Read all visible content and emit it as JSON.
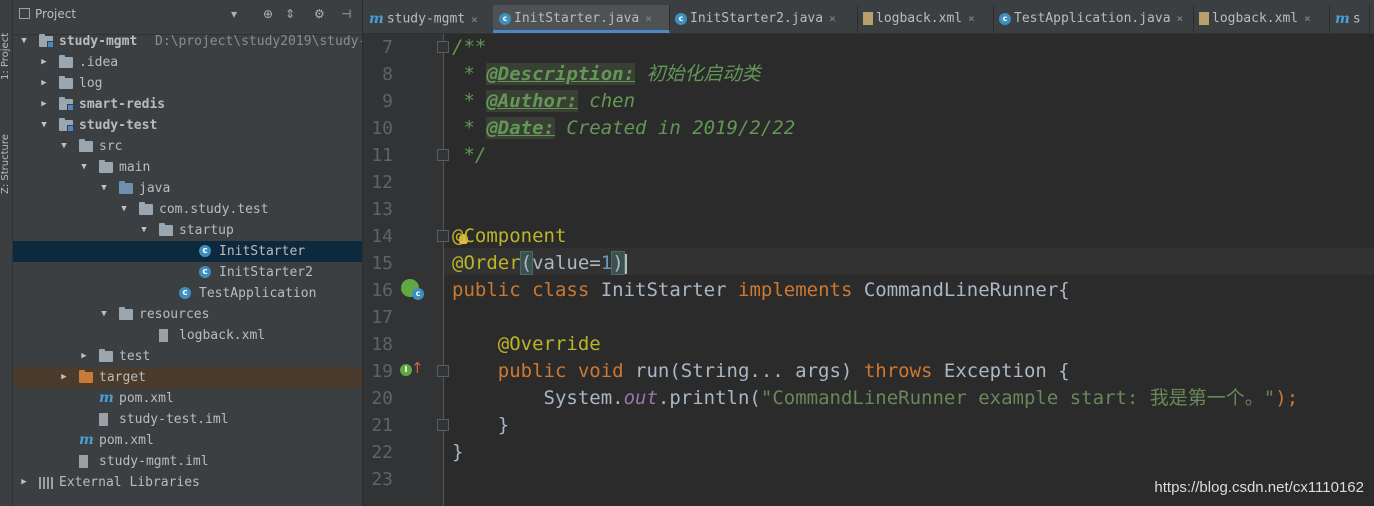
{
  "tool_strip": {
    "project_tab": "1: Project",
    "structure_tab": "Z: Structure"
  },
  "project_panel": {
    "title": "Project",
    "tree": [
      {
        "label": "study-mgmt",
        "path": "D:\\project\\study2019\\study-",
        "icon": "module-folder-icon",
        "arrow": "expanded",
        "level": 0,
        "bold": true
      },
      {
        "label": ".idea",
        "icon": "folder-icon",
        "arrow": "collapsed",
        "level": 1
      },
      {
        "label": "log",
        "icon": "folder-icon",
        "arrow": "collapsed",
        "level": 1
      },
      {
        "label": "smart-redis",
        "icon": "module-folder-icon",
        "arrow": "collapsed",
        "level": 1,
        "bold": true
      },
      {
        "label": "study-test",
        "icon": "module-folder-icon",
        "arrow": "expanded",
        "level": 1,
        "bold": true
      },
      {
        "label": "src",
        "icon": "folder-icon",
        "arrow": "expanded",
        "level": 2
      },
      {
        "label": "main",
        "icon": "folder-icon",
        "arrow": "expanded",
        "level": 3
      },
      {
        "label": "java",
        "icon": "source-folder-icon",
        "arrow": "expanded",
        "level": 4
      },
      {
        "label": "com.study.test",
        "icon": "package-icon",
        "arrow": "expanded",
        "level": 5
      },
      {
        "label": "startup",
        "icon": "package-icon",
        "arrow": "expanded",
        "level": 6
      },
      {
        "label": "InitStarter",
        "icon": "java-class-icon",
        "arrow": "none",
        "level": 8,
        "selected": true
      },
      {
        "label": "InitStarter2",
        "icon": "java-class-icon",
        "arrow": "none",
        "level": 8
      },
      {
        "label": "TestApplication",
        "icon": "spring-boot-class-icon",
        "arrow": "none",
        "level": 7
      },
      {
        "label": "resources",
        "icon": "resources-folder-icon",
        "arrow": "expanded",
        "level": 4
      },
      {
        "label": "logback.xml",
        "icon": "xml-file-icon",
        "arrow": "none",
        "level": 6
      },
      {
        "label": "test",
        "icon": "folder-icon",
        "arrow": "collapsed",
        "level": 3
      },
      {
        "label": "target",
        "icon": "excluded-folder-icon",
        "arrow": "collapsed",
        "level": 2,
        "excluded": true
      },
      {
        "label": "pom.xml",
        "icon": "maven-icon",
        "arrow": "none",
        "level": 3
      },
      {
        "label": "study-test.iml",
        "icon": "iml-file-icon",
        "arrow": "none",
        "level": 3
      },
      {
        "label": "pom.xml",
        "icon": "maven-icon",
        "arrow": "none",
        "level": 2
      },
      {
        "label": "study-mgmt.iml",
        "icon": "iml-file-icon",
        "arrow": "none",
        "level": 2
      },
      {
        "label": "External Libraries",
        "icon": "libraries-icon",
        "arrow": "collapsed",
        "level": 0
      }
    ]
  },
  "tabs": [
    {
      "label": "study-mgmt",
      "icon": "maven-icon"
    },
    {
      "label": "InitStarter.java",
      "icon": "java-class-icon",
      "active": true
    },
    {
      "label": "InitStarter2.java",
      "icon": "java-class-icon"
    },
    {
      "label": "logback.xml",
      "icon": "xml-file-icon"
    },
    {
      "label": "TestApplication.java",
      "icon": "spring-boot-class-icon"
    },
    {
      "label": "logback.xml",
      "icon": "xml-file-icon"
    },
    {
      "label": "s",
      "icon": "maven-icon"
    }
  ],
  "editor": {
    "line_numbers": [
      "7",
      "8",
      "9",
      "10",
      "11",
      "12",
      "13",
      "14",
      "15",
      "16",
      "17",
      "18",
      "19",
      "20",
      "21",
      "22",
      "23"
    ],
    "line7": "/**",
    "line8_prefix": " * ",
    "line8_tag": "@Description:",
    "line8_text": " 初始化启动类",
    "line9_prefix": " * ",
    "line9_tag": "@Author:",
    "line9_text": " chen",
    "line10_prefix": " * ",
    "line10_tag": "@Date:",
    "line10_text": " Created in 2019/2/22",
    "line11": " */",
    "line14": "@Component",
    "line15_ann": "@Order",
    "line15_open": "(",
    "line15_param": "value",
    "line15_eq": "=",
    "line15_num": "1",
    "line15_close": ")",
    "line16_kw": "public class",
    "line16_name": " InitStarter ",
    "line16_kw2": "implements",
    "line16_rest": " CommandLineRunner{",
    "line18_ann": "    @Override",
    "line19_kw": "    public void",
    "line19_mid": " run(String... args) ",
    "line19_kw2": "throws",
    "line19_rest": " Exception {",
    "line20_pre": "        System.",
    "line20_static": "out",
    "line20_mid": ".println(",
    "line20_str": "\"CommandLineRunner example start: 我是第一个。\"",
    "line20_end": ");",
    "line21": "    }",
    "line22": "}"
  },
  "watermark": "https://blog.csdn.net/cx1110162"
}
